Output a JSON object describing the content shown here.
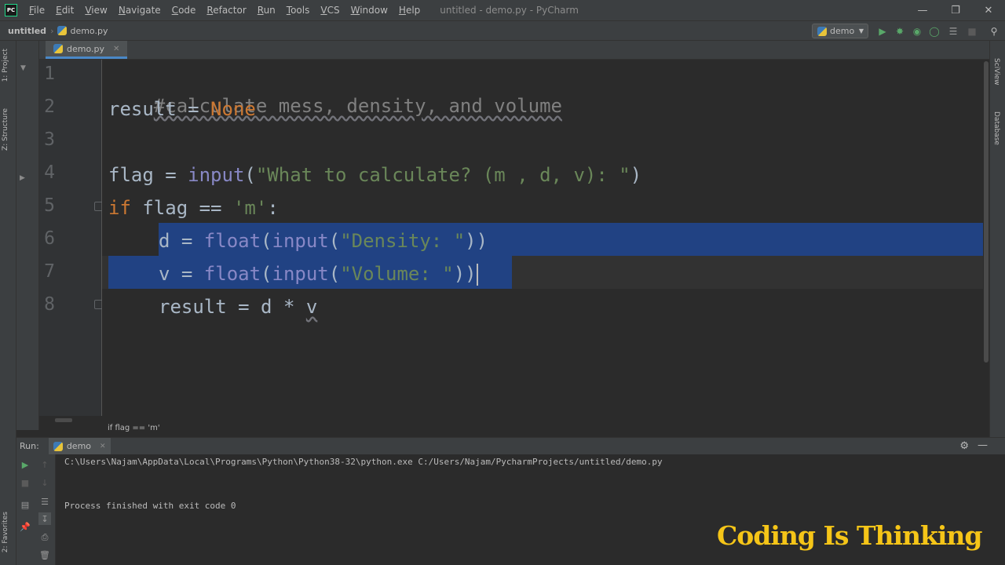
{
  "menubar": {
    "logo": "PC",
    "items": [
      "File",
      "Edit",
      "View",
      "Navigate",
      "Code",
      "Refactor",
      "Run",
      "Tools",
      "VCS",
      "Window",
      "Help"
    ],
    "window_title": "untitled - demo.py - PyCharm"
  },
  "navbar": {
    "project": "untitled",
    "file": "demo.py",
    "run_config": "demo"
  },
  "left_strip": {
    "project_tab": "1: Project",
    "structure_tab": "Z: Structure",
    "favorites_tab": "2: Favorites"
  },
  "right_strip": {
    "sciview_tab": "SciView",
    "database_tab": "Database"
  },
  "editor": {
    "tab_label": "demo.py",
    "line_numbers": [
      "1",
      "2",
      "3",
      "4",
      "5",
      "6",
      "7",
      "8"
    ],
    "lines": {
      "l1_comment": "#calculate mess, density, and volume",
      "l2_var": "result = ",
      "l2_none": "None",
      "l4_var": "flag = ",
      "l4_input": "input",
      "l4_open": "(",
      "l4_str": "\"What to calculate? (m , d, v): \"",
      "l4_close": ")",
      "l5_if": "if",
      "l5_cond": " flag == ",
      "l5_str": "'m'",
      "l5_colon": ":",
      "l6_var": "d = ",
      "l6_float": "float",
      "l6_open1": "(",
      "l6_input": "input",
      "l6_open2": "(",
      "l6_str": "\"Density: \"",
      "l6_close": "))",
      "l7_var": "v = ",
      "l7_float": "float",
      "l7_open1": "(",
      "l7_input": "input",
      "l7_open2": "(",
      "l7_str": "\"Volume: \"",
      "l7_close": "))",
      "l8_expr": "result = d * ",
      "l8_v": "v"
    },
    "breadcrumb": "if flag == 'm'"
  },
  "run_panel": {
    "label": "Run:",
    "tab": "demo",
    "command": "C:\\Users\\Najam\\AppData\\Local\\Programs\\Python\\Python38-32\\python.exe C:/Users/Najam/PycharmProjects/untitled/demo.py",
    "exit_message": "Process finished with exit code 0"
  },
  "watermark": "Coding Is Thinking",
  "colors": {
    "selection": "#214283",
    "keyword": "#cc7832",
    "string": "#6a8759",
    "builtin": "#8888c6",
    "watermark": "#f5c518"
  }
}
